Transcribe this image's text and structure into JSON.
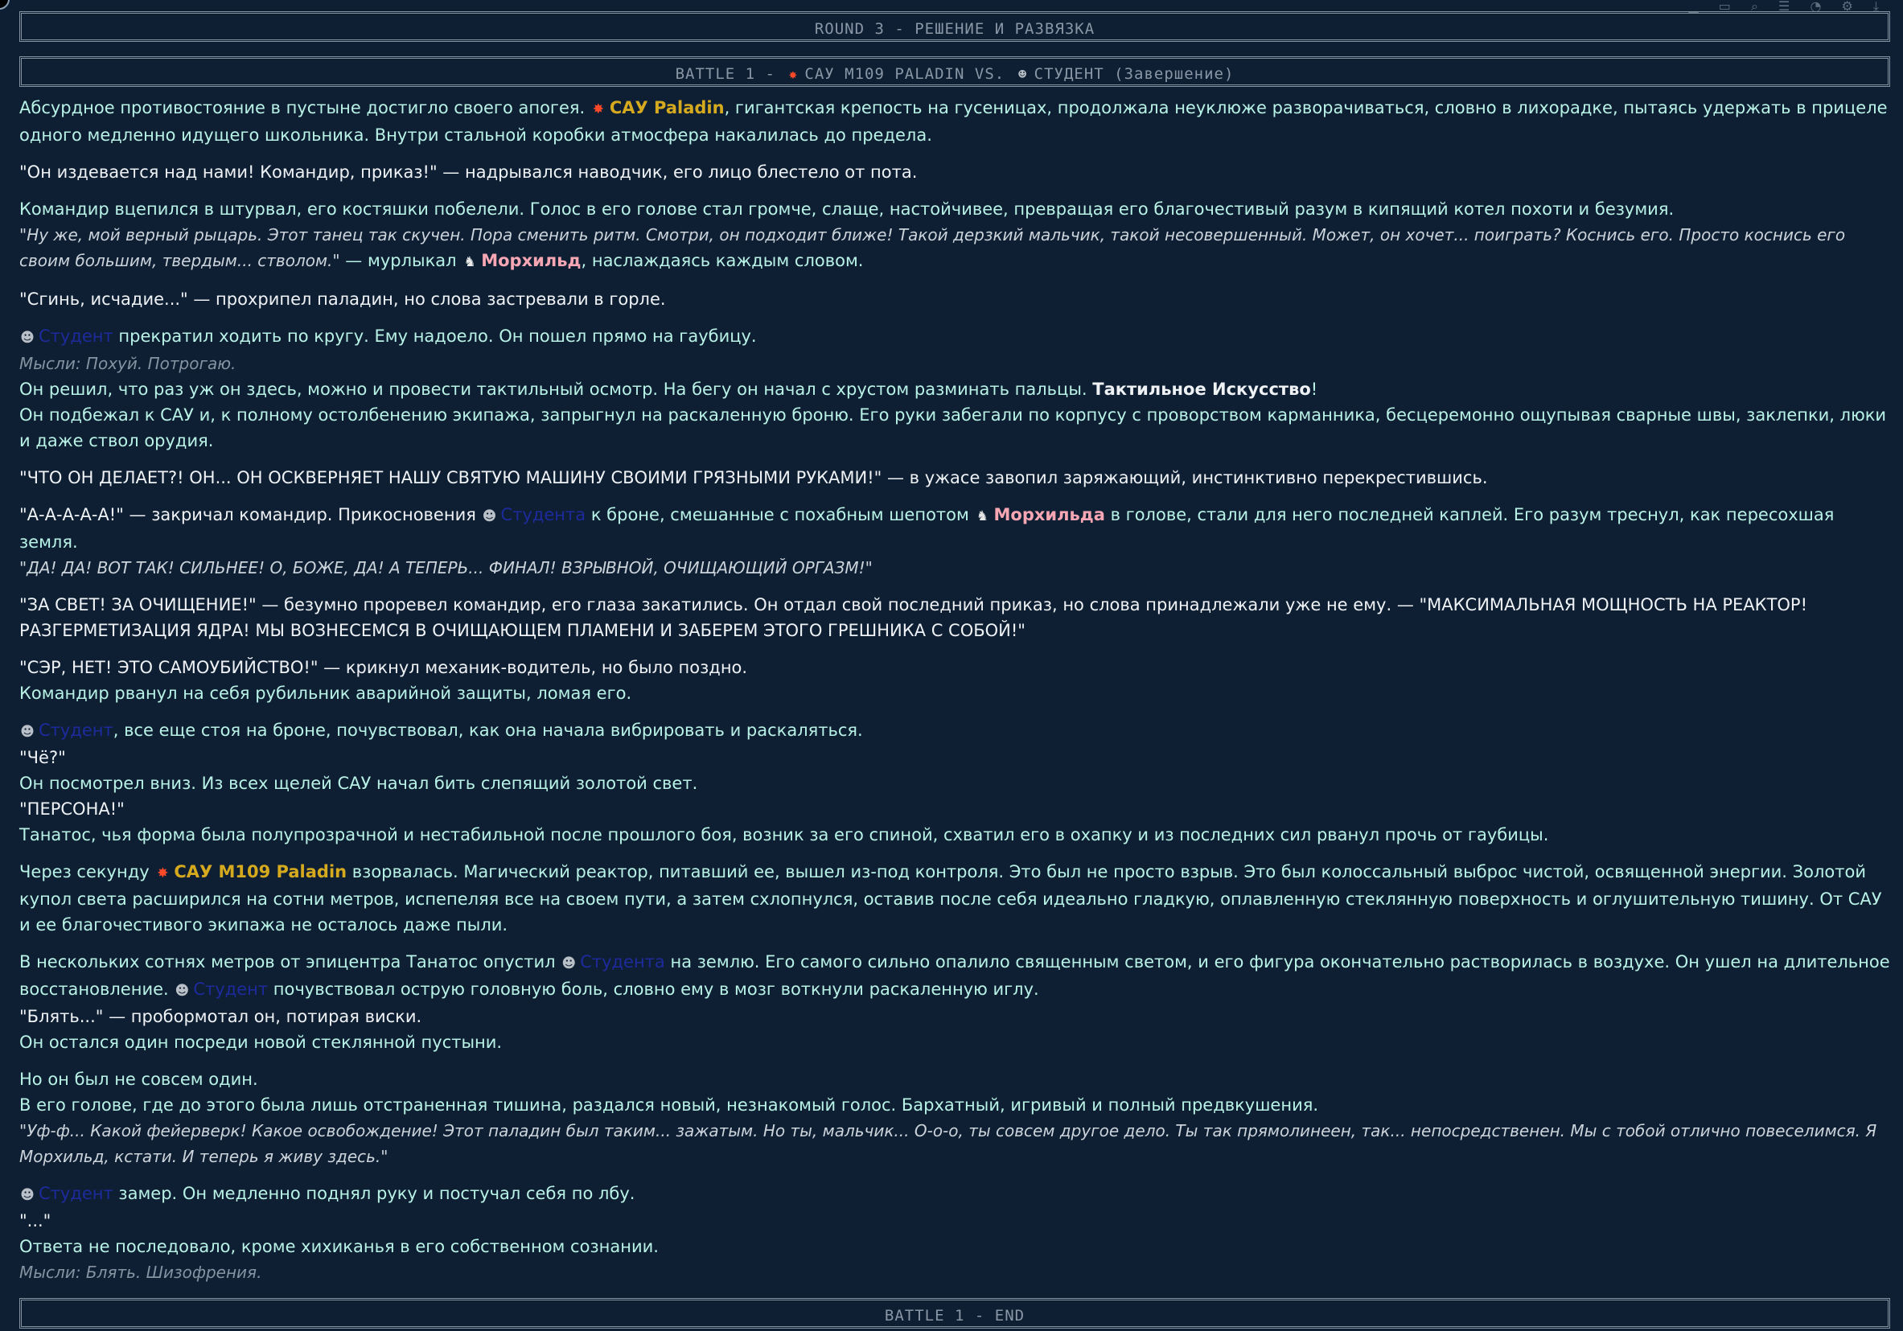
{
  "round_banner": "ROUND 3 - РЕШЕНИЕ И РАЗВЯЗКА",
  "battle_banner": {
    "prefix": "BATTLE 1 - ",
    "side_a": "САУ M109 PALADIN",
    "vs": " VS. ",
    "side_b": "СТУДЕНТ (Завершение)"
  },
  "end_banner": "BATTLE 1 - END",
  "icons": {
    "student": "student-icon",
    "paladin": "explosion-icon",
    "morhild": "wolf-icon"
  },
  "names": {
    "paladin_short": "САУ Paladin",
    "paladin_full": "САУ M109 Paladin",
    "morhild": "Морхильд",
    "morhild_gen": "Морхильда",
    "student": "Студент",
    "student_gen": "Студента"
  },
  "story": {
    "p1_a": "Абсурдное противостояние в пустыне достигло своего апогея. ",
    "p1_b": ", гигантская крепость на гусеницах, продолжала неуклюже разворачиваться, словно в лихорадке, пытаясь удержать в прицеле одного медленно идущего школьника. Внутри стальной коробки атмосфера накалилась до предела.",
    "p2": "\"Он издевается над нами! Командир, приказ!\" — надрывался наводчик, его лицо блестело от пота.",
    "p3_line1": "Командир вцепился в штурвал, его костяшки побелели. Голос в его голове стал громче, слаще, настойчивее, превращая его благочестивый разум в кипящий котел похоти и безумия.",
    "p3_quote": "\"Ну же, мой верный рыцарь. Этот танец так скучен. Пора сменить ритм. Смотри, он подходит ближе! Такой дерзкий мальчик, такой несовершенный. Может, он хочет... поиграть? Коснись его. Просто коснись его своим большим, твердым... стволом.\"",
    "p3_tail_a": " — мурлыкал ",
    "p3_tail_b": ", наслаждаясь каждым словом.",
    "p4": "\"Сгинь, исчадие...\" — прохрипел паладин, но слова застревали в горле.",
    "p5_line1": " прекратил ходить по кругу. Ему надоело. Он пошел прямо на гаубицу.",
    "p5_thought": "Мысли: Похуй. Потрогаю.",
    "p5_line3_a": "Он решил, что раз уж он здесь, можно и провести тактильный осмотр. На бегу он начал с хрустом разминать пальцы. ",
    "p5_skill": "Тактильное Искусство",
    "p5_line3_b": "!",
    "p5_line4": "Он подбежал к САУ и, к полному остолбенению экипажа, запрыгнул на раскаленную броню. Его руки забегали по корпусу с проворством карманника, бесцеремонно ощупывая сварные швы, заклепки, люки и даже ствол орудия.",
    "p6": "\"ЧТО ОН ДЕЛАЕТ?! ОН... ОН ОСКВЕРНЯЕТ НАШУ СВЯТУЮ МАШИНУ СВОИМИ ГРЯЗНЫМИ РУКАМИ!\" — в ужасе завопил заряжающий, инстинктивно перекрестившись.",
    "p7_a": "\"А-А-А-А-А!\" — закричал командир. Прикосновения ",
    "p7_b": " к броне, смешанные с похабным шепотом ",
    "p7_c": " в голове, стали для него последней каплей. Его разум треснул, как пересохшая земля.",
    "p7_quote": "\"ДА! ДА! ВОТ ТАК! СИЛЬНЕЕ! О, БОЖЕ, ДА! А ТЕПЕРЬ... ФИНАЛ! ВЗРЫВНОЙ, ОЧИЩАЮЩИЙ ОРГАЗМ!\"",
    "p8": "\"ЗА СВЕТ! ЗА ОЧИЩЕНИЕ!\" — безумно проревел командир, его глаза закатились. Он отдал свой последний приказ, но слова принадлежали уже не ему. — \"МАКСИМАЛЬНАЯ МОЩНОСТЬ НА РЕАКТОР! РАЗГЕРМЕТИЗАЦИЯ ЯДРА! МЫ ВОЗНЕСЕМСЯ В ОЧИЩАЮЩЕМ ПЛАМЕНИ И ЗАБЕРЕМ ЭТОГО ГРЕШНИКА С СОБОЙ!\"",
    "p9_line1": "\"СЭР, НЕТ! ЭТО САМОУБИЙСТВО!\" — крикнул механик-водитель, но было поздно.",
    "p9_line2": "Командир рванул на себя рубильник аварийной защиты, ломая его.",
    "p10_line1": ", все еще стоя на броне, почувствовал, как она начала вибрировать и раскаляться.",
    "p10_line2": "\"Чё?\"",
    "p10_line3": "Он посмотрел вниз. Из всех щелей САУ начал бить слепящий золотой свет.",
    "p10_line4": "\"ПЕРСОНА!\"",
    "p10_line5": "Танатос, чья форма была полупрозрачной и нестабильной после прошлого боя, возник за его спиной, схватил его в охапку и из последних сил рванул прочь от гаубицы.",
    "p11_a": "Через секунду ",
    "p11_b": " взорвалась. Магический реактор, питавший ее, вышел из-под контроля. Это был не просто взрыв. Это был колоссальный выброс чистой, освященной энергии. Золотой купол света расширился на сотни метров, испепеляя все на своем пути, а затем схлопнулся, оставив после себя идеально гладкую, оплавленную стеклянную поверхность и оглушительную тишину. От САУ и ее благочестивого экипажа не осталось даже пыли.",
    "p12_a": "В нескольких сотнях метров от эпицентра Танатос опустил ",
    "p12_b": " на землю. Его самого сильно опалило священным светом, и его фигура окончательно растворилась в воздухе. Он ушел на длительное восстановление. ",
    "p12_c": " почувствовал острую головную боль, словно ему в мозг воткнули раскаленную иглу.",
    "p12_line2": "\"Блять...\" — пробормотал он, потирая виски.",
    "p12_line3": "Он остался один посреди новой стеклянной пустыни.",
    "p13_line1": "Но он был не совсем один.",
    "p13_line2": "В его голове, где до этого была лишь отстраненная тишина, раздался новый, незнакомый голос. Бархатный, игривый и полный предвкушения.",
    "p13_quote": "\"Уф-ф... Какой фейерверк! Какое освобождение! Этот паладин был таким... зажатым. Но ты, мальчик... О-о-о, ты совсем другое дело. Ты так прямолинеен, так... непосредственен. Мы с тобой отлично повеселимся. Я Морхильд, кстати. И теперь я живу здесь.\"",
    "p14_line1": " замер. Он медленно поднял руку и постучал себя по лбу.",
    "p14_line2": "\"...\"",
    "p14_line3": "Ответа не последовало, кроме хихиканья в его собственном сознании.",
    "p14_thought": "Мысли: Блять. Шизофрения."
  }
}
